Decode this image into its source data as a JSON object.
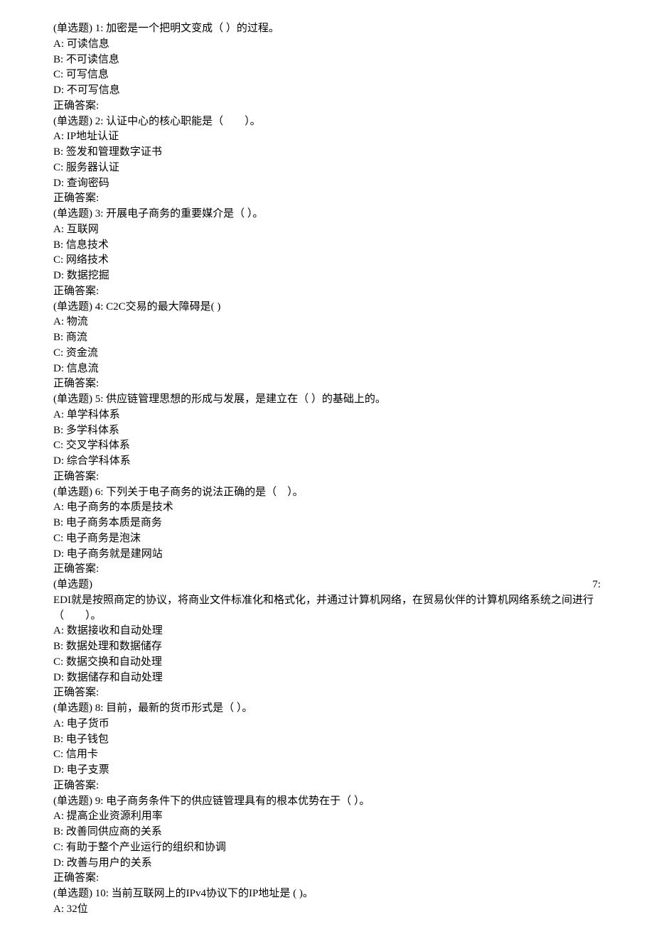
{
  "questions": [
    {
      "prefix": "(单选题) 1: ",
      "stem": "加密是一个把明文变成（ ）的过程。",
      "options": [
        "A: 可读信息",
        "B: 不可读信息",
        "C: 可写信息",
        "D: 不可写信息"
      ],
      "answer": "正确答案:"
    },
    {
      "prefix": "(单选题) 2: ",
      "stem": "认证中心的核心职能是（　　）。",
      "options": [
        "A: IP地址认证",
        "B: 签发和管理数字证书",
        "C: 服务器认证",
        "D: 查询密码"
      ],
      "answer": "正确答案:"
    },
    {
      "prefix": "(单选题) 3: ",
      "stem": "开展电子商务的重要媒介是（ ）。",
      "options": [
        "A: 互联网",
        "B: 信息技术",
        "C: 网络技术",
        "D: 数据挖掘"
      ],
      "answer": "正确答案:"
    },
    {
      "prefix": "(单选题) 4: ",
      "stem": "C2C交易的最大障碍是( )",
      "options": [
        "A: 物流",
        "B: 商流",
        "C: 资金流",
        "D: 信息流"
      ],
      "answer": "正确答案:"
    },
    {
      "prefix": "(单选题) 5: ",
      "stem": "供应链管理思想的形成与发展，是建立在（ ）的基础上的。",
      "options": [
        "A: 单学科体系",
        "B: 多学科体系",
        "C: 交叉学科体系",
        "D: 综合学科体系"
      ],
      "answer": "正确答案:"
    },
    {
      "prefix": "(单选题) 6: ",
      "stem": "下列关于电子商务的说法正确的是（　）。",
      "options": [
        "A: 电子商务的本质是技术",
        "B: 电子商务本质是商务",
        "C: 电子商务是泡沫",
        "D: 电子商务就是建网站"
      ],
      "answer": "正确答案:"
    },
    {
      "prefix_left": "(单选题)",
      "prefix_right": "7:",
      "stem_wrap": "EDI就是按照商定的协议，将商业文件标准化和格式化，并通过计算机网络，在贸易伙伴的计算机网络系统之间进行（　　）。",
      "options": [
        "A: 数据接收和自动处理",
        "B: 数据处理和数据储存",
        "C: 数据交换和自动处理",
        "D: 数据储存和自动处理"
      ],
      "answer": "正确答案:"
    },
    {
      "prefix": "(单选题) 8: ",
      "stem": "目前，最新的货币形式是（ ）。",
      "options": [
        "A: 电子货币",
        "B: 电子钱包",
        "C: 信用卡",
        "D: 电子支票"
      ],
      "answer": "正确答案:"
    },
    {
      "prefix": "(单选题) 9: ",
      "stem": "电子商务条件下的供应链管理具有的根本优势在于（ ）。",
      "options": [
        "A: 提高企业资源利用率",
        "B: 改善同供应商的关系",
        "C: 有助于整个产业运行的组织和协调",
        "D: 改善与用户的关系"
      ],
      "answer": "正确答案:"
    },
    {
      "prefix": "(单选题) 10: ",
      "stem": "当前互联网上的IPv4协议下的IP地址是 ( )。",
      "options": [
        "A: 32位"
      ],
      "answer": ""
    }
  ]
}
